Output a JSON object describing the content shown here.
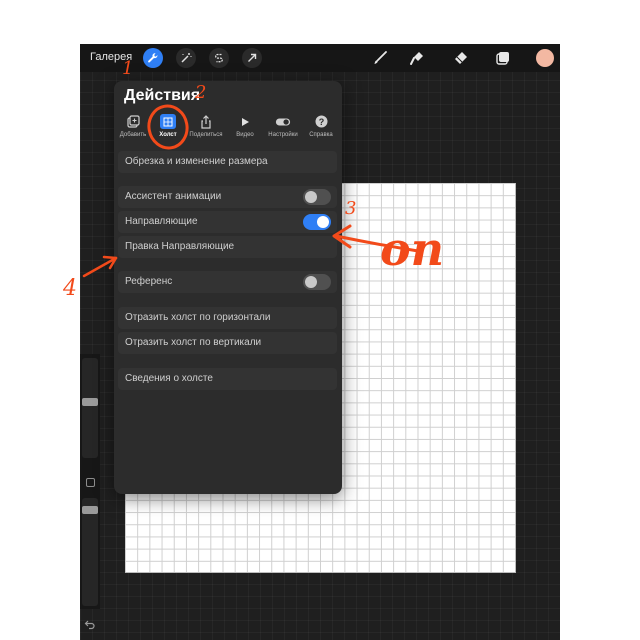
{
  "toolbar": {
    "gallery_label": "Галерея",
    "left_icons": [
      "wrench-icon",
      "magic-wand-icon",
      "selection-s-icon",
      "move-arrow-icon"
    ],
    "right_icons": [
      "brush-icon",
      "smudge-icon",
      "eraser-icon",
      "layers-icon",
      "color-swatch"
    ],
    "color_swatch": "#f3b8a2",
    "accent": "#2f7ff5"
  },
  "panel": {
    "title": "Действия",
    "tabs": [
      {
        "label": "Добавить",
        "icon": "add-icon"
      },
      {
        "label": "Холст",
        "icon": "canvas-icon",
        "active": true
      },
      {
        "label": "Поделиться",
        "icon": "share-icon"
      },
      {
        "label": "Видео",
        "icon": "play-icon"
      },
      {
        "label": "Настройки",
        "icon": "toggle-icon"
      },
      {
        "label": "Справка",
        "icon": "help-icon"
      }
    ],
    "rows": {
      "crop": "Обрезка и изменение размера",
      "animation_assist": "Ассистент анимации",
      "drawing_guide": "Направляющие",
      "edit_drawing_guide": "Правка Направляющие",
      "reference": "Референс",
      "flip_horizontal": "Отразить холст по горизонтали",
      "flip_vertical": "Отразить холст по вертикали",
      "canvas_info": "Сведения о холсте"
    },
    "toggles": {
      "animation_assist": false,
      "drawing_guide": true,
      "reference": false
    }
  },
  "annotations": {
    "n1": "1",
    "n2": "2",
    "n3": "3",
    "n4": "4",
    "on_text": "on",
    "color": "#f24a1a"
  }
}
